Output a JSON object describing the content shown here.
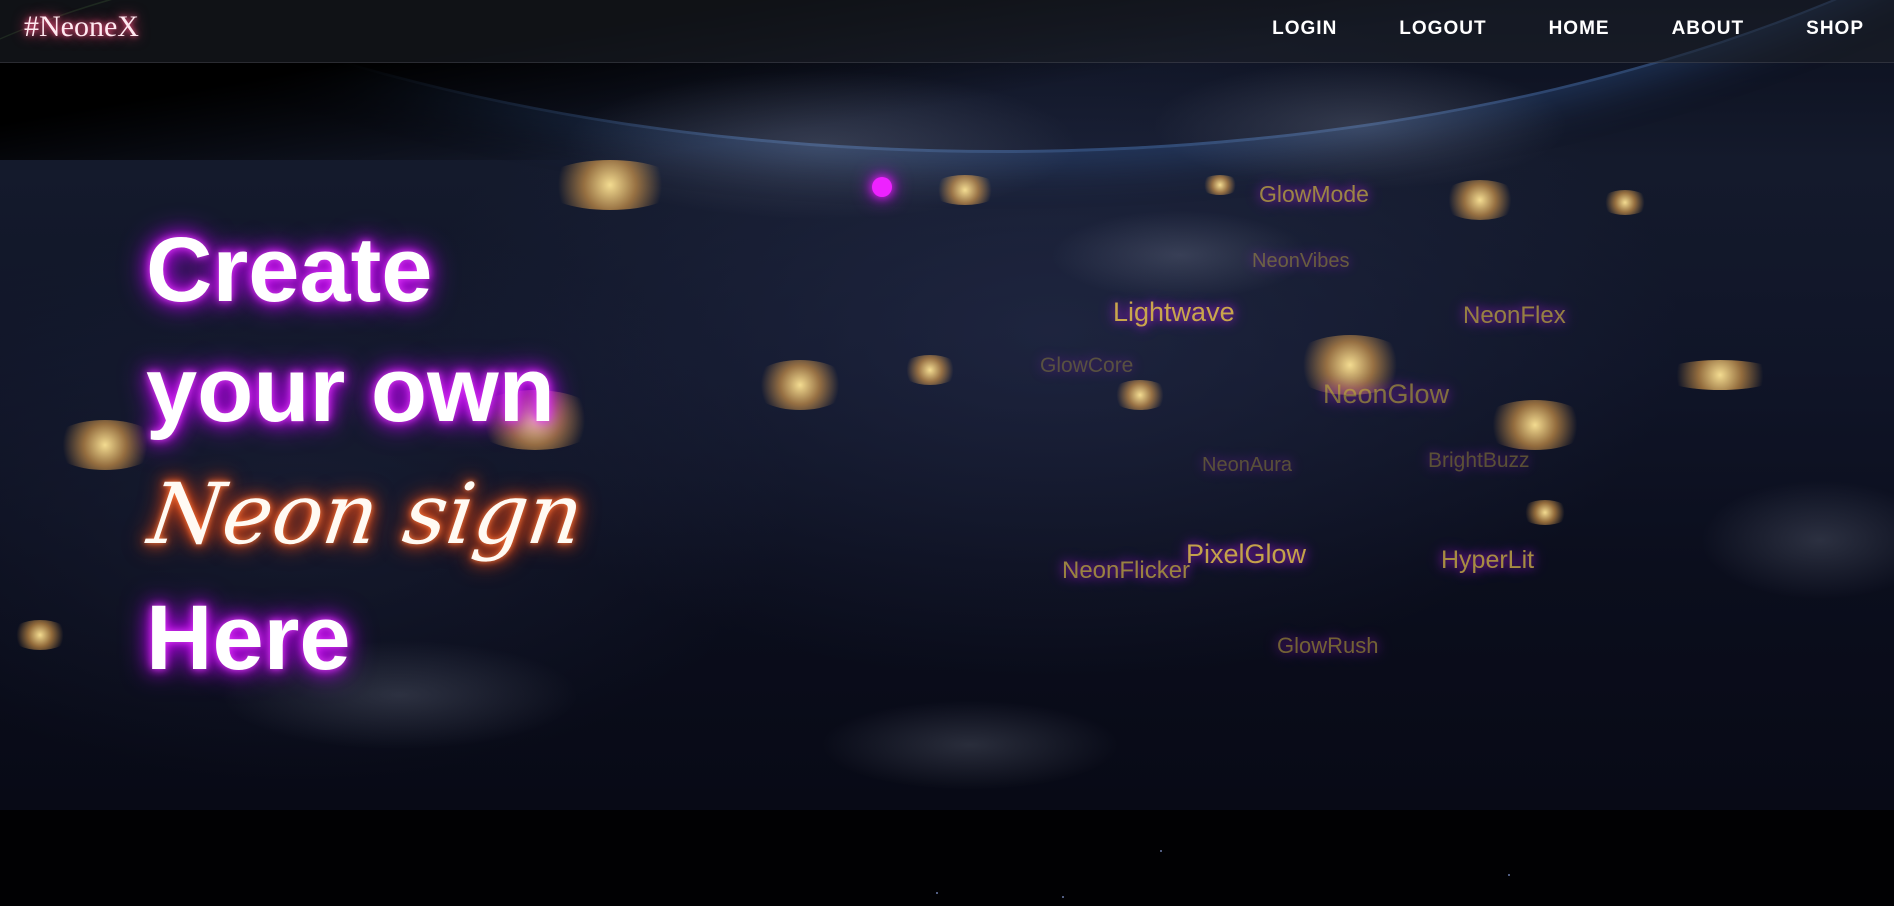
{
  "navbar": {
    "brand": "#NeoneX",
    "links": [
      "LOGIN",
      "LOGOUT",
      "HOME",
      "ABOUT",
      "SHOP"
    ]
  },
  "hero": {
    "line1": "Create",
    "line2": "your own",
    "line3": "Neon sign",
    "line4": "Here"
  },
  "word_cloud": {
    "glowmode": "GlowMode",
    "neonvibes": "NeonVibes",
    "lightwave": "Lightwave",
    "neonflex": "NeonFlex",
    "glowcore": "GlowCore",
    "neonglow": "NeonGlow",
    "neonaura": "NeonAura",
    "brightbuzz": "BrightBuzz",
    "pixelglow": "PixelGlow",
    "neonflicker": "NeonFlicker",
    "hyperlit": "HyperLit",
    "glowrush": "GlowRush"
  },
  "colors": {
    "heading_glow": "#d500f9",
    "script_glow": "#ff5a1f",
    "brand_glow": "#ff5a8a",
    "dot": "#ee22ff",
    "word_text": "#c9a84a"
  }
}
